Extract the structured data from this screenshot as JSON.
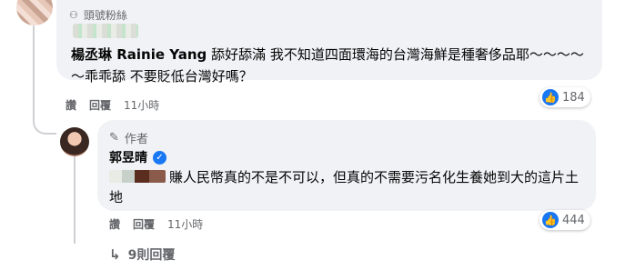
{
  "top_comment": {
    "badge_label": "頭號粉絲",
    "mention": "楊丞琳 Rainie Yang",
    "text": "舔好舔滿 我不知道四面環海的台灣海鮮是種奢侈品耶～～～～～乖乖舔 不要貶低台灣好嗎？",
    "actions": {
      "like": "讚",
      "reply": "回覆",
      "time": "11小時"
    },
    "reaction_count": "184"
  },
  "author_reply": {
    "author_label": "作者",
    "name": "郭昱晴",
    "text": "賺人民幣真的不是不可以，但真的不需要污名化生養她到大的這片土地",
    "actions": {
      "like": "讚",
      "reply": "回覆",
      "time": "11小時"
    },
    "reaction_count": "444"
  },
  "more_replies": "9則回覆",
  "colors": {
    "bubble": "#f0f2f5",
    "like_blue": "#1877f2",
    "meta_gray": "#65676b"
  }
}
